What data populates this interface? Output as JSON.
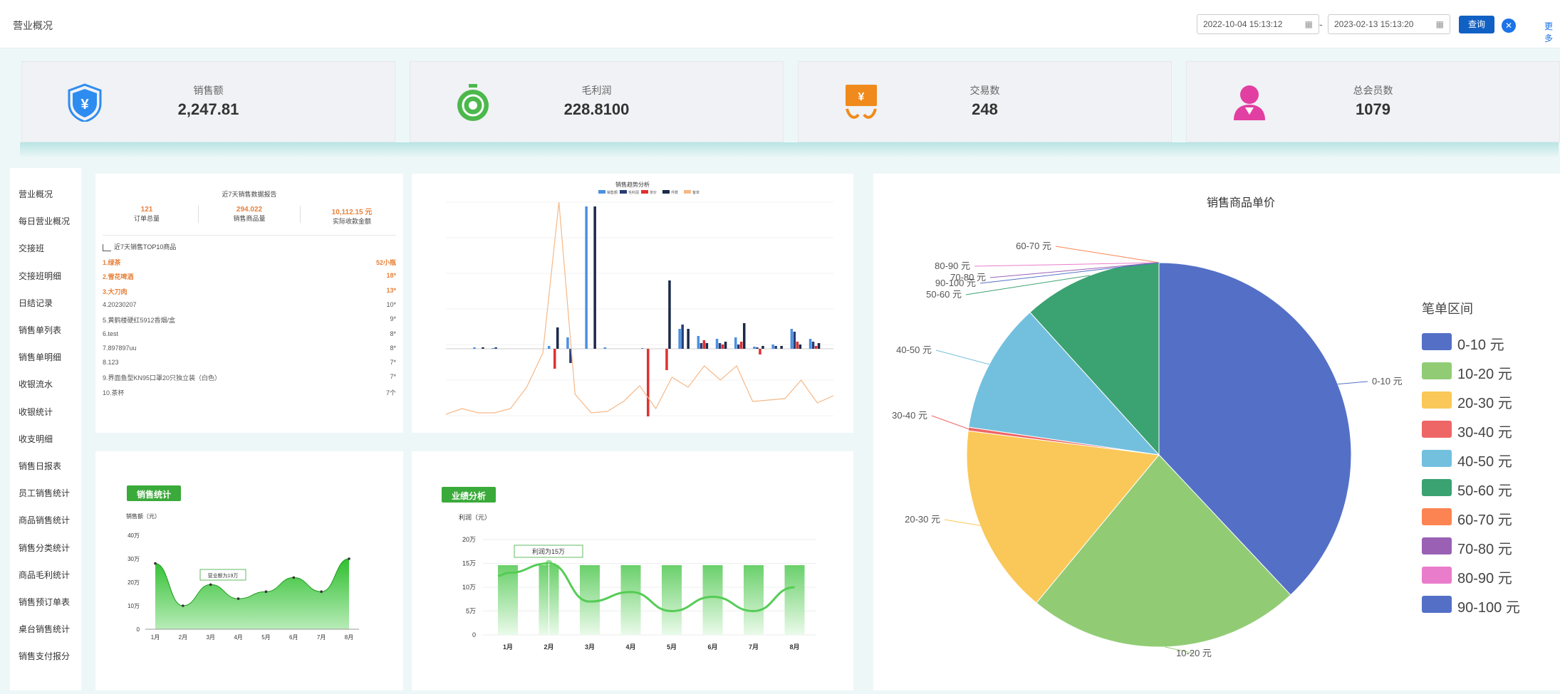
{
  "header": {
    "title": "营业概况",
    "date_start": "2022-10-04 15:13:12",
    "date_end": "2023-02-13 15:13:20",
    "separator": "-",
    "query_label": "查询",
    "more_label": "更多"
  },
  "stats": [
    {
      "label": "销售额",
      "value": "2,247.81",
      "icon": "shield-yen-icon",
      "color": "#2d8cf0"
    },
    {
      "label": "毛利润",
      "value": "228.8100",
      "icon": "stopwatch-icon",
      "color": "#4cb84c"
    },
    {
      "label": "交易数",
      "value": "248",
      "icon": "hand-money-icon",
      "color": "#f08a1c"
    },
    {
      "label": "总会员数",
      "value": "1079",
      "icon": "member-icon",
      "color": "#e23fa2"
    }
  ],
  "sidebar": {
    "items": [
      "营业概况",
      "每日营业概况",
      "交接班",
      "交接班明细",
      "日结记录",
      "销售单列表",
      "销售单明细",
      "收银流水",
      "收银统计",
      "收支明细",
      "销售日报表",
      "员工销售统计",
      "商品销售统计",
      "销售分类统计",
      "商品毛利统计",
      "销售预订单表",
      "桌台销售统计",
      "销售支付报分"
    ]
  },
  "report": {
    "title": "近7天销售数据报告",
    "metrics": [
      {
        "value": "121",
        "label": "订单总量"
      },
      {
        "value": "294.022",
        "label": "销售商品量"
      },
      {
        "value": "10,112.15",
        "unit": "元",
        "label": "实际收款金额"
      }
    ],
    "top_title": "近7天销售TOP10商品",
    "top_items": [
      {
        "name": "1.绿茶",
        "qty": "52小瓶",
        "hl": true
      },
      {
        "name": "2.雪花啤酒",
        "qty": "18*",
        "hl": true
      },
      {
        "name": "3.大刀肉",
        "qty": "13*",
        "hl": true
      },
      {
        "name": "4.20230207",
        "qty": "10*",
        "hl": false
      },
      {
        "name": "5.黄鹤楼硬红5912香烟/盒",
        "qty": "9*",
        "hl": false
      },
      {
        "name": "6.test",
        "qty": "8*",
        "hl": false
      },
      {
        "name": "7.897897uu",
        "qty": "8*",
        "hl": false
      },
      {
        "name": "8.123",
        "qty": "7*",
        "hl": false
      },
      {
        "name": "9.界面鱼型KN95口罩20只独立装（白色）",
        "qty": "7*",
        "hl": false
      },
      {
        "name": "10.茶杯",
        "qty": "7个",
        "hl": false
      }
    ]
  },
  "trend_chart": {
    "title": "销售趋势分析",
    "legend": [
      "销售额",
      "毛利润",
      "单价",
      "件数",
      "客单"
    ],
    "series_colors": [
      "#4a90e2",
      "#273c75",
      "#e03030",
      "#1b2a4a",
      "#f5b887"
    ]
  },
  "sales_stats": {
    "tag": "销售统计",
    "ylabel": "销售额（元）",
    "yticks": [
      "0",
      "10万",
      "20万",
      "30万",
      "40万"
    ],
    "xticks": [
      "1月",
      "2月",
      "3月",
      "4月",
      "5月",
      "6月",
      "7月",
      "8月"
    ],
    "tooltip": "营业额为19万",
    "values": [
      28,
      10,
      19,
      13,
      16,
      22,
      16,
      30
    ],
    "ymax": 40
  },
  "performance": {
    "tag": "业绩分析",
    "ylabel": "利润（元）",
    "yticks": [
      "0",
      "5万",
      "10万",
      "15万",
      "20万"
    ],
    "xticks": [
      "1月",
      "2月",
      "3月",
      "4月",
      "5月",
      "6月",
      "7月",
      "8月"
    ],
    "tooltip": "利润为15万",
    "values": [
      13,
      15,
      7,
      9,
      5,
      8,
      5,
      10
    ],
    "ymax": 20
  },
  "chart_data": {
    "type": "pie",
    "title": "销售商品单价",
    "legend_title": "笔单区间",
    "legend_position": "right",
    "categories": [
      "0-10 元",
      "10-20 元",
      "20-30 元",
      "30-40 元",
      "40-50 元",
      "50-60 元",
      "60-70 元",
      "70-80 元",
      "80-90 元",
      "90-100 元"
    ],
    "values": [
      38,
      23,
      16,
      0.3,
      11,
      11.7,
      0,
      0,
      0,
      0
    ],
    "colors": [
      "#5470c6",
      "#91cc75",
      "#fac858",
      "#ee6666",
      "#73c0de",
      "#3ba272",
      "#fc8452",
      "#9a60b4",
      "#ea7ccc",
      "#5470c6"
    ]
  }
}
